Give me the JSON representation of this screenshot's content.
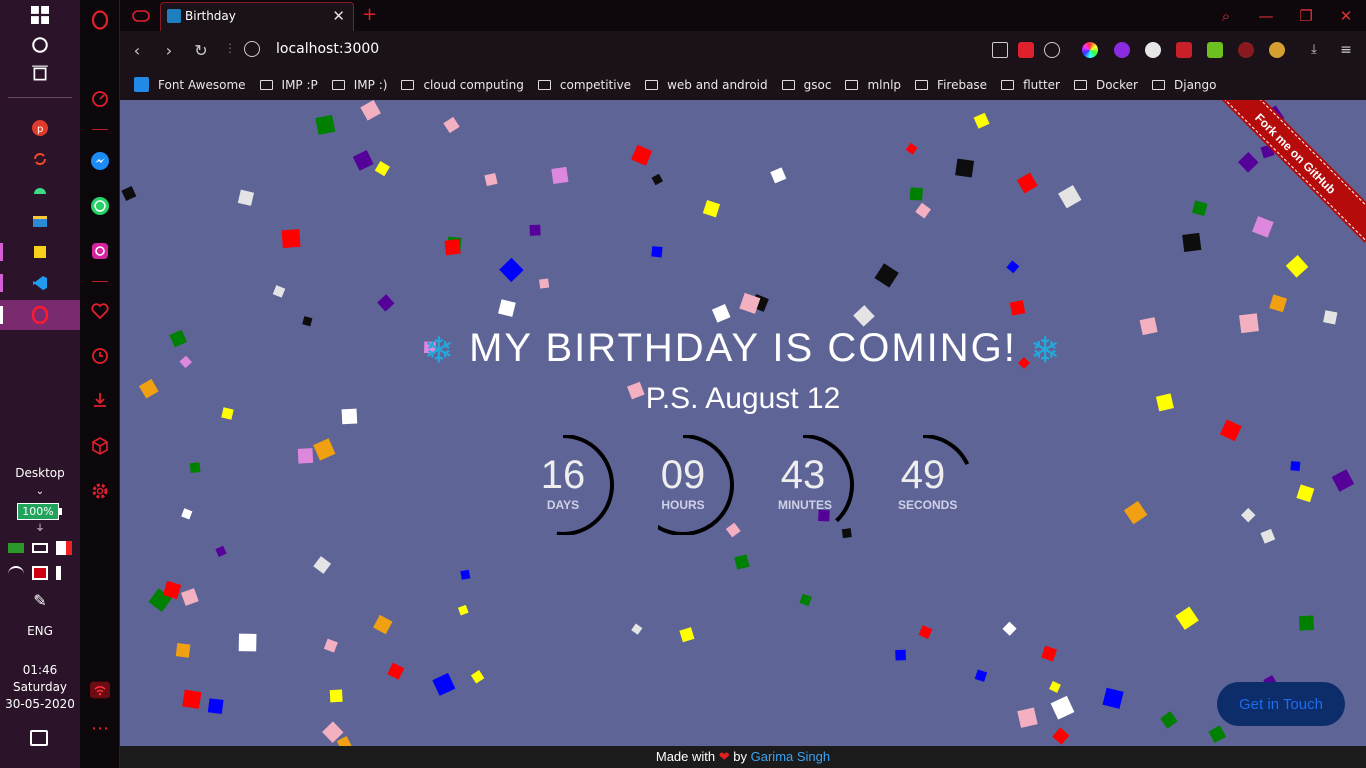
{
  "taskbar": {
    "desktop_label": "Desktop",
    "battery": "100%",
    "lang": "ENG",
    "time": "01:46",
    "day": "Saturday",
    "date": "30-05-2020"
  },
  "browser": {
    "tab_title": "Birthday",
    "url": "localhost:3000",
    "bookmarks": [
      "Font Awesome",
      "IMP :P",
      "IMP :)",
      "cloud computing",
      "competitive",
      "web and android",
      "gsoc",
      "mlnlp",
      "Firebase",
      "flutter",
      "Docker",
      "Django"
    ]
  },
  "page": {
    "heading": "MY BIRTHDAY IS COMING!",
    "subheading": "P.S. August 12",
    "countdown": [
      {
        "value": "16",
        "label": "DAYS",
        "fraction": 0.52
      },
      {
        "value": "09",
        "label": "HOURS",
        "fraction": 0.62
      },
      {
        "value": "43",
        "label": "MINUTES",
        "fraction": 0.38
      },
      {
        "value": "49",
        "label": "SECONDS",
        "fraction": 0.18
      }
    ],
    "ribbon": "Fork me on GitHub",
    "contact": "Get in Touch",
    "footer_prefix": "Made with",
    "footer_heart": "❤",
    "footer_by": "by",
    "footer_author": "Garima Singh"
  },
  "colors": {
    "page_bg": "#5e6496",
    "confetti": [
      "#ffffff",
      "#e4e4e4",
      "#0d0d0d",
      "#ff0000",
      "#ffff00",
      "#f0a010",
      "#0000ff",
      "#008000",
      "#550099",
      "#dd88dd",
      "#f2b0c0"
    ]
  }
}
